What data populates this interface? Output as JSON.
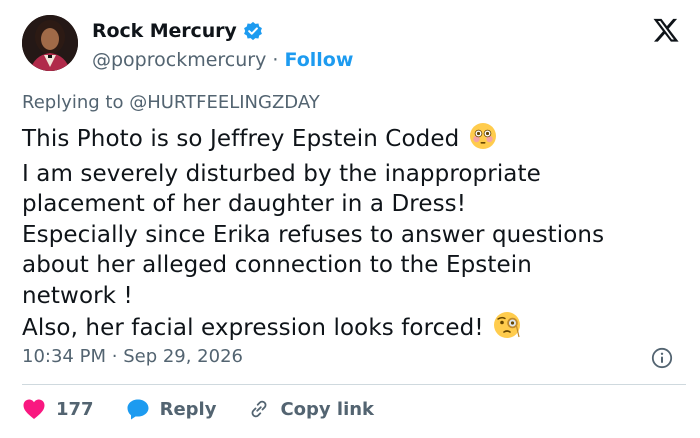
{
  "author": {
    "name": "Rock Mercury",
    "handle": "@poprockmercury",
    "separator": "·",
    "follow_label": "Follow",
    "verified_color": "#1d9bf0"
  },
  "reply_context": {
    "prefix": "Replying to",
    "mention": "@HURTFEELINGZDAY"
  },
  "tweet": {
    "lines": [
      "This Photo is so Jeffrey Epstein Coded",
      "I am severely disturbed by the inappropriate",
      "placement of her daughter in a Dress!",
      "Especially since Erika refuses to answer questions",
      "about her alleged connection to the Epstein",
      "network !",
      "Also, her facial expression looks forced!"
    ],
    "emoji_line1": "flushed-face-emoji",
    "emoji_last": "face-with-monocle-emoji"
  },
  "meta": {
    "time": "10:34 PM",
    "separator": "·",
    "date": "Sep 29, 2026"
  },
  "actions": {
    "like_count": "177",
    "reply_label": "Reply",
    "copy_label": "Copy link"
  },
  "colors": {
    "like": "#f91880",
    "reply": "#1d9bf0",
    "secondary_text": "#536471",
    "accent": "#1d9bf0"
  },
  "icons": [
    "x-logo-icon",
    "verified-badge-icon",
    "info-icon",
    "heart-icon",
    "reply-bubble-icon",
    "link-icon"
  ]
}
